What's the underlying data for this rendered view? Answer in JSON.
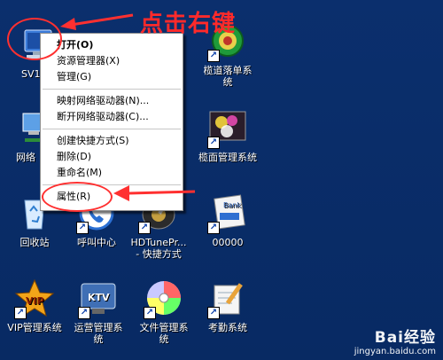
{
  "annotation": {
    "text": "点击右键"
  },
  "desktop_icons": [
    {
      "id": "sv",
      "label": "SV1"
    },
    {
      "id": "lidao",
      "label": "榄道落单系统"
    },
    {
      "id": "wangluo",
      "label": "网络"
    },
    {
      "id": "taimian",
      "label": "榄面管理系统"
    },
    {
      "id": "recycle",
      "label": "回收站"
    },
    {
      "id": "callcenter",
      "label": "呼叫中心"
    },
    {
      "id": "hdtune",
      "label": "HDTunePr... - 快捷方式"
    },
    {
      "id": "bank",
      "label": "00000"
    },
    {
      "id": "vip",
      "label": "VIP管理系统"
    },
    {
      "id": "ktv",
      "label": "运营管理系统"
    },
    {
      "id": "docmgr",
      "label": "文件管理系统"
    },
    {
      "id": "kaoqin",
      "label": "考勤系统"
    }
  ],
  "context_menu": {
    "items": [
      {
        "label": "打开(O)",
        "bold": true
      },
      {
        "label": "资源管理器(X)"
      },
      {
        "label": "管理(G)"
      },
      {
        "label": "映射网络驱动器(N)..."
      },
      {
        "label": "断开网络驱动器(C)..."
      },
      {
        "label": "创建快捷方式(S)"
      },
      {
        "label": "删除(D)"
      },
      {
        "label": "重命名(M)"
      },
      {
        "label": "属性(R)"
      }
    ]
  },
  "watermark": {
    "brand": "Bai经验",
    "url": "jingyan.baidu.com"
  },
  "colors": {
    "desktop": "#0b2f6d",
    "annotation": "#ff2a2a"
  }
}
